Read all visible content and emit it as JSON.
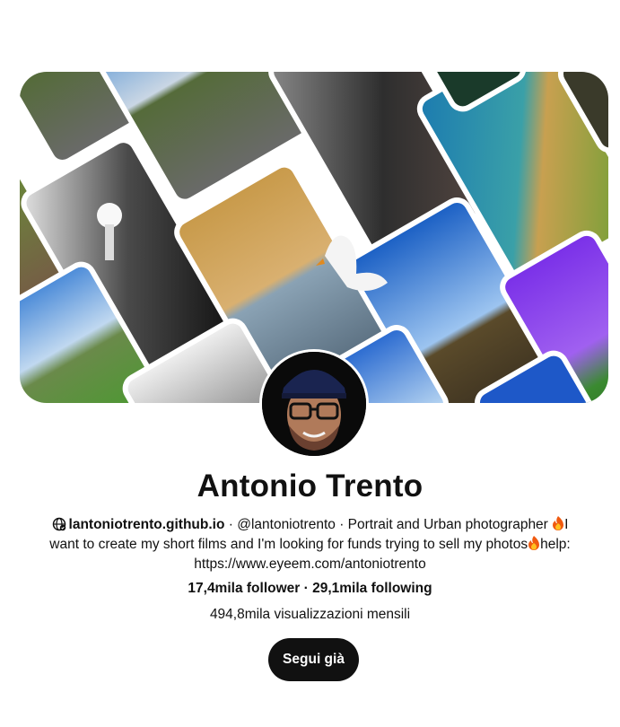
{
  "profile": {
    "name": "Antonio Trento",
    "website": "lantoniotrento.github.io",
    "separator": " · ",
    "handle": "@lantoniotrento",
    "bio_part1": "Portrait and Urban photographer ",
    "bio_part2": "I want to create my short films and I'm looking for funds trying to sell my photos",
    "bio_part3": "help: https://www.eyeem.com/antoniotrento",
    "followers": "17,4mila follower",
    "following": "29,1mila following",
    "monthly_views": "494,8mila visualizzazioni mensili",
    "follow_button": "Segui già"
  },
  "icons": {
    "website": "globe-icon",
    "emoji": "fire-emoji-icon",
    "avatar": "profile-avatar",
    "cover": "cover-photo-collage"
  },
  "colors": {
    "text": "#111111",
    "button_bg": "#111111",
    "button_text": "#ffffff",
    "background": "#ffffff"
  }
}
